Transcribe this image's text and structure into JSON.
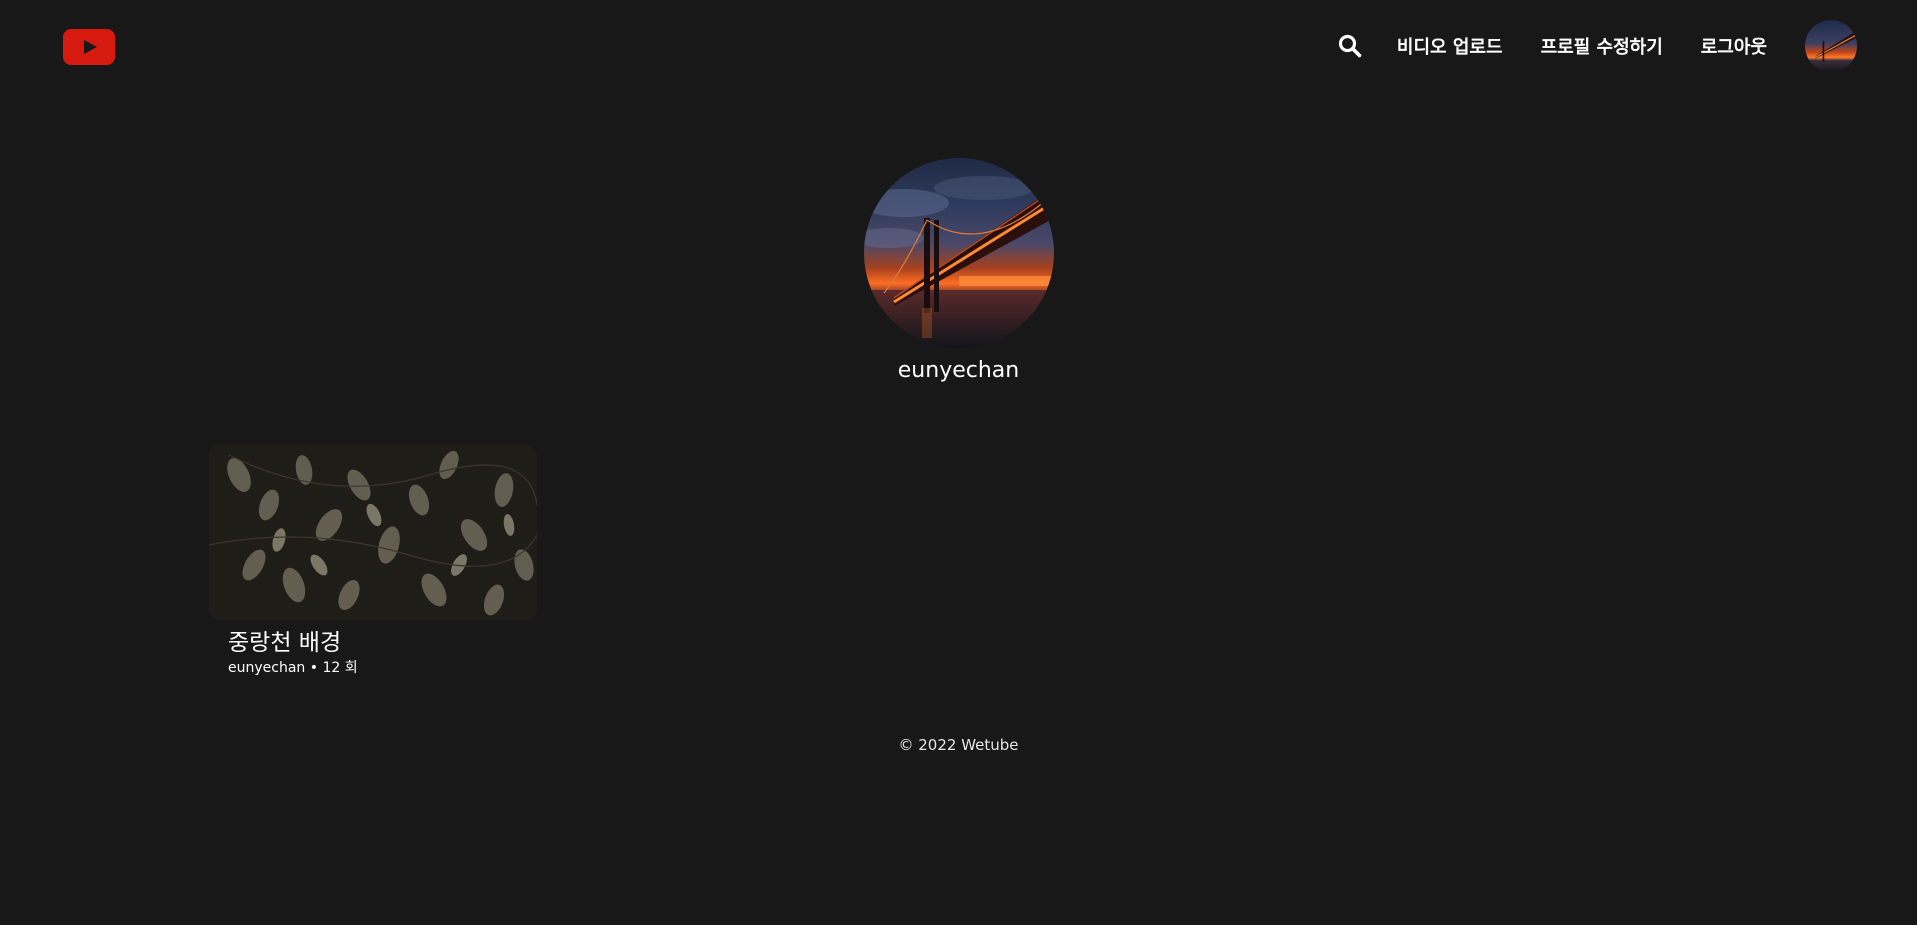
{
  "header": {
    "logo_alt": "youtube-logo",
    "search_icon": "search-icon",
    "nav": {
      "upload": "비디오 업로드",
      "edit_profile": "프로필 수정하기",
      "logout": "로그아웃"
    },
    "avatar_icon": "bridge-avatar"
  },
  "profile": {
    "username": "eunyechan"
  },
  "videos": [
    {
      "title": "중랑천 배경",
      "owner": "eunyechan",
      "separator": " • ",
      "views": "12 회"
    }
  ],
  "footer": {
    "copyright": "© 2022 Wetube"
  },
  "colors": {
    "background": "#181818",
    "brand": "#d71a10",
    "text": "#ffffff"
  }
}
